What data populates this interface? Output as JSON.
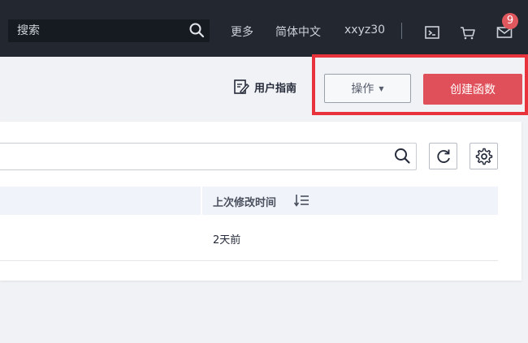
{
  "header": {
    "search_placeholder": "搜索",
    "more": "更多",
    "language": "简体中文",
    "username": "xxyz30",
    "icons": [
      "terminal-icon",
      "cart-icon",
      "mail-icon"
    ],
    "notification_count": "9"
  },
  "actions": {
    "user_guide": "用户指南",
    "operations": "操作",
    "create_function": "创建函数"
  },
  "table": {
    "columns": [
      "上次修改时间"
    ],
    "rows": [
      {
        "last_modified": "2天前"
      }
    ]
  },
  "colors": {
    "topbar": "#232730",
    "primary_button": "#e0505a",
    "highlight": "#e8323c",
    "badge": "#e0585e"
  }
}
